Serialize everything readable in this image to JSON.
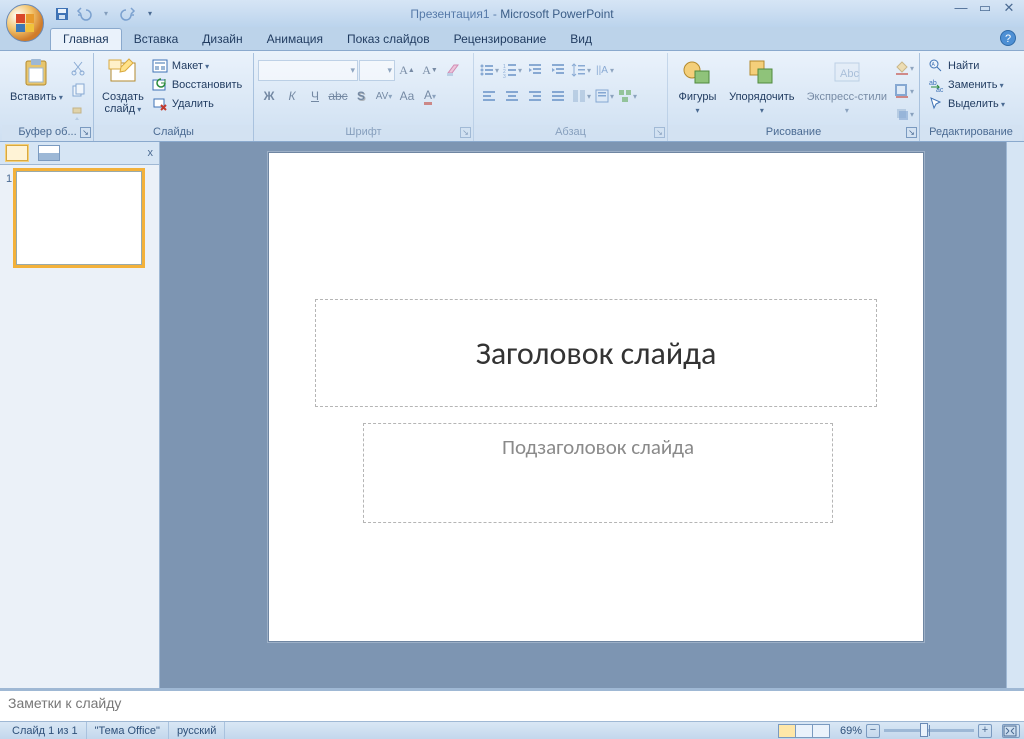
{
  "title": {
    "doc": "Презентация1",
    "app": "Microsoft PowerPoint"
  },
  "tabs": [
    "Главная",
    "Вставка",
    "Дизайн",
    "Анимация",
    "Показ слайдов",
    "Рецензирование",
    "Вид"
  ],
  "ribbon": {
    "clipboard": {
      "label": "Буфер об...",
      "paste": "Вставить"
    },
    "slides": {
      "label": "Слайды",
      "new": "Создать\nслайд",
      "layout": "Макет",
      "reset": "Восстановить",
      "delete": "Удалить"
    },
    "font": {
      "label": "Шрифт",
      "name": "",
      "size": ""
    },
    "paragraph": {
      "label": "Абзац"
    },
    "drawing": {
      "label": "Рисование",
      "shapes": "Фигуры",
      "arrange": "Упорядочить",
      "quick": "Экспресс-стили"
    },
    "editing": {
      "label": "Редактирование",
      "find": "Найти",
      "replace": "Заменить",
      "select": "Выделить"
    }
  },
  "slide": {
    "title_ph": "Заголовок слайда",
    "subtitle_ph": "Подзаголовок слайда"
  },
  "thumbs": {
    "num1": "1"
  },
  "notes": {
    "placeholder": "Заметки к слайду"
  },
  "status": {
    "slide": "Слайд 1 из 1",
    "theme": "\"Тема Office\"",
    "lang": "русский",
    "zoom": "69%"
  }
}
